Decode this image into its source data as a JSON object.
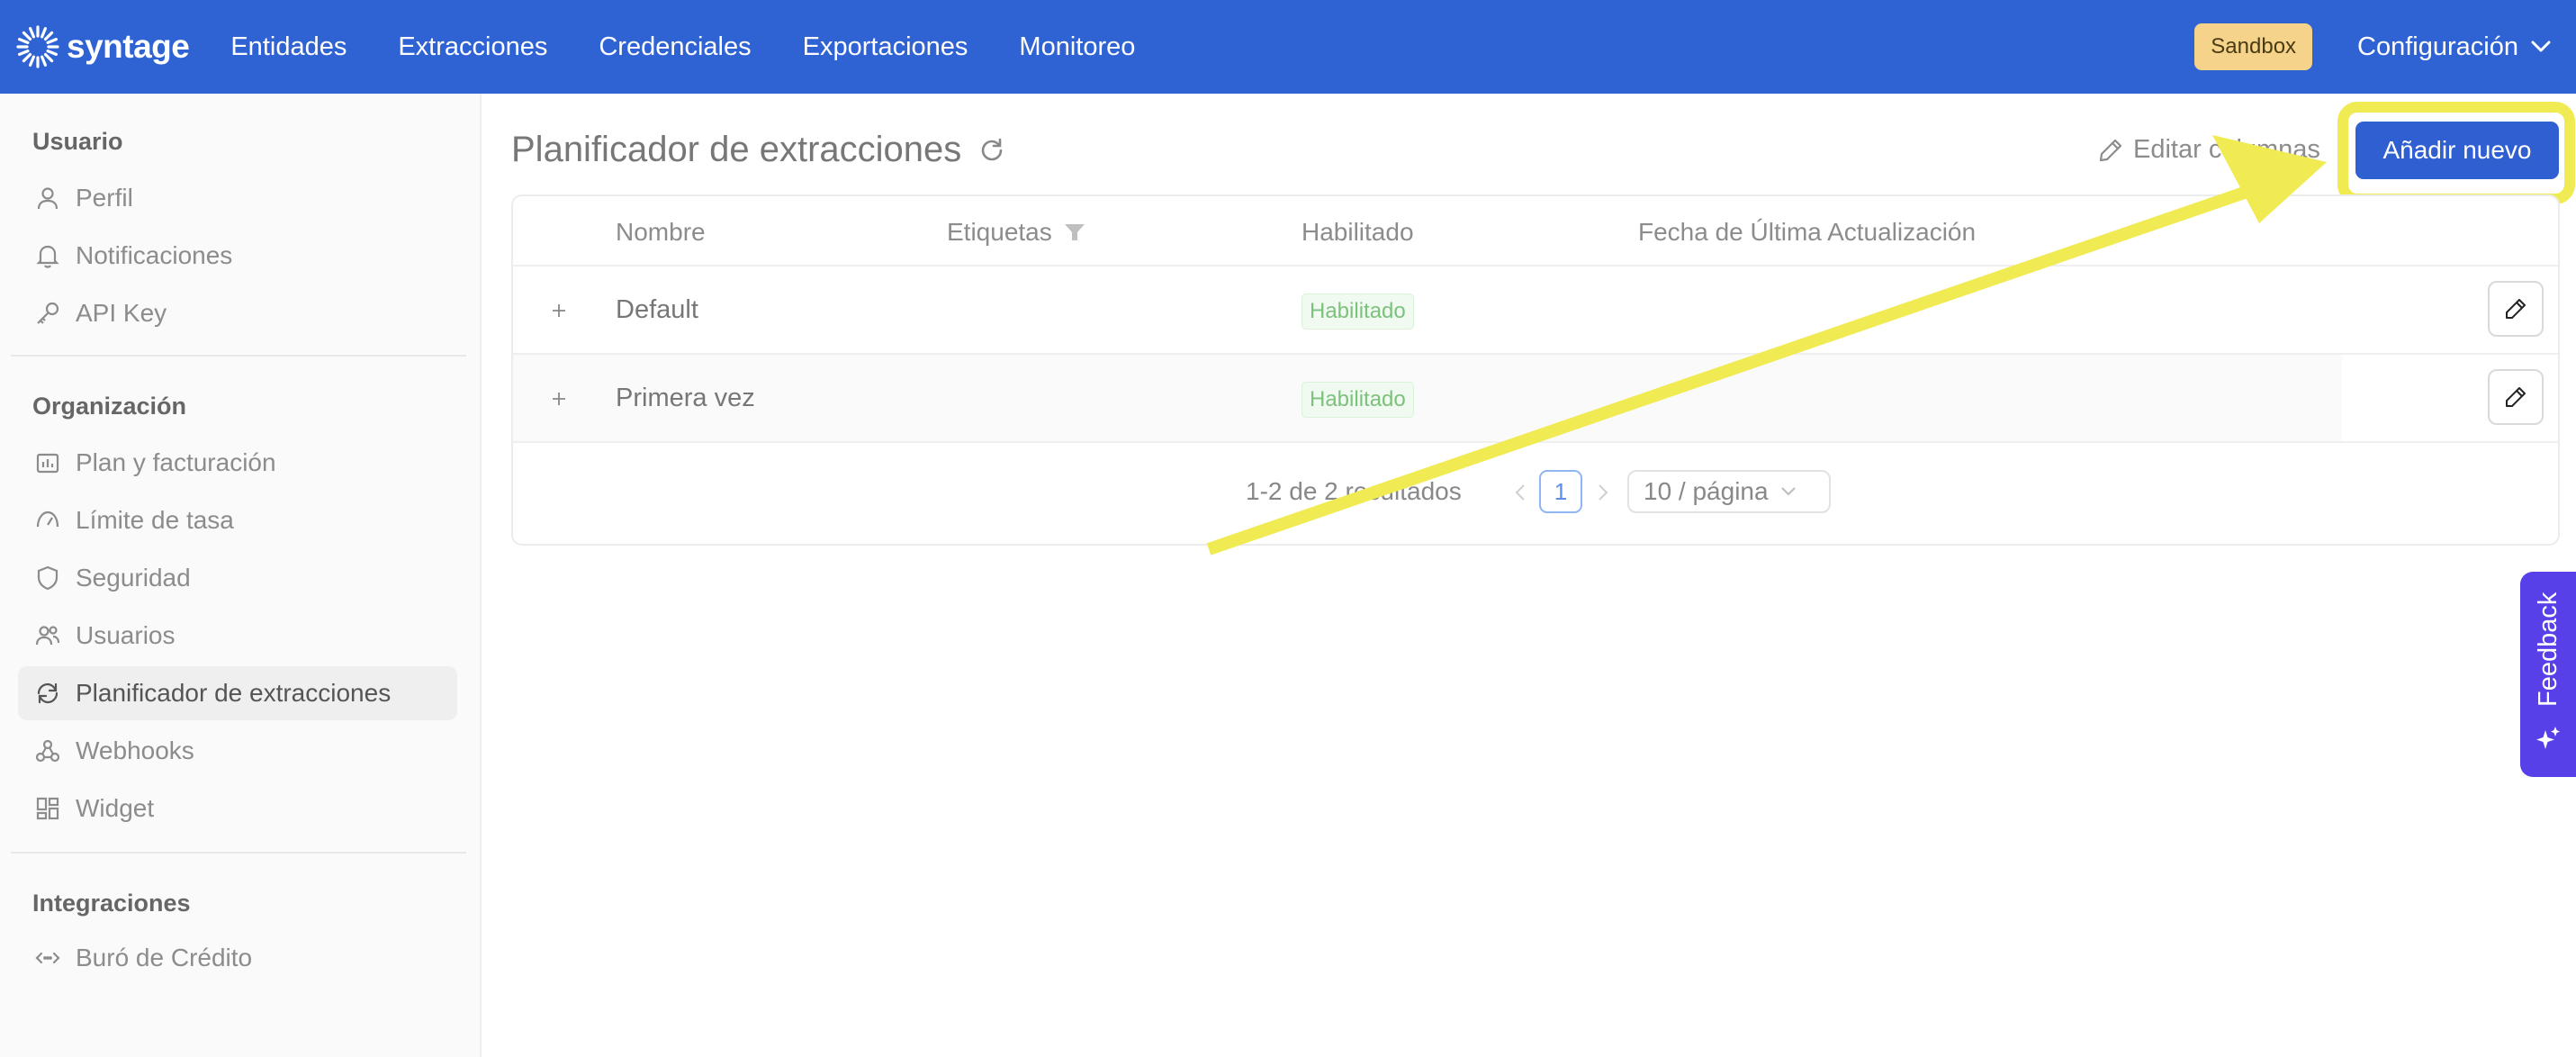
{
  "brand": {
    "name": "syntage",
    "primary_color": "#2f63d4",
    "highlight_color": "#f0ea53"
  },
  "nav": [
    {
      "label": "Entidades"
    },
    {
      "label": "Extracciones"
    },
    {
      "label": "Credenciales"
    },
    {
      "label": "Exportaciones"
    },
    {
      "label": "Monitoreo"
    }
  ],
  "header": {
    "environment_badge": "Sandbox",
    "config_label": "Configuración"
  },
  "sidebar": {
    "sections": [
      {
        "title": "Usuario"
      },
      {
        "title": "Organización"
      },
      {
        "title": "Integraciones"
      }
    ],
    "items": [
      {
        "label": "Perfil",
        "icon": "user-icon"
      },
      {
        "label": "Notificaciones",
        "icon": "bell-icon"
      },
      {
        "label": "API Key",
        "icon": "key-icon"
      },
      {
        "label": "Plan y facturación",
        "icon": "billing-chart-icon"
      },
      {
        "label": "Límite de tasa",
        "icon": "gauge-icon"
      },
      {
        "label": "Seguridad",
        "icon": "shield-icon"
      },
      {
        "label": "Usuarios",
        "icon": "users-icon"
      },
      {
        "label": "Planificador de extracciones",
        "icon": "refresh-icon",
        "active": true
      },
      {
        "label": "Webhooks",
        "icon": "webhook-icon"
      },
      {
        "label": "Widget",
        "icon": "widget-grid-icon"
      },
      {
        "label": "Buró de Crédito",
        "icon": "code-arrows-icon"
      }
    ]
  },
  "main": {
    "title": "Planificador de extracciones",
    "edit_columns_label": "Editar columnas",
    "add_button_label": "Añadir nuevo",
    "table": {
      "columns": [
        "Nombre",
        "Etiquetas",
        "Habilitado",
        "Fecha de Última Actualización"
      ],
      "rows": [
        {
          "name": "Default",
          "tags": "",
          "status": "Habilitado",
          "updated": ""
        },
        {
          "name": "Primera vez",
          "tags": "",
          "status": "Habilitado",
          "updated": ""
        }
      ]
    },
    "pagination": {
      "summary": "1-2 de 2 resultados",
      "current_page": "1",
      "page_size": "10 / página"
    }
  },
  "feedback_tab": {
    "label": "Feedback"
  }
}
